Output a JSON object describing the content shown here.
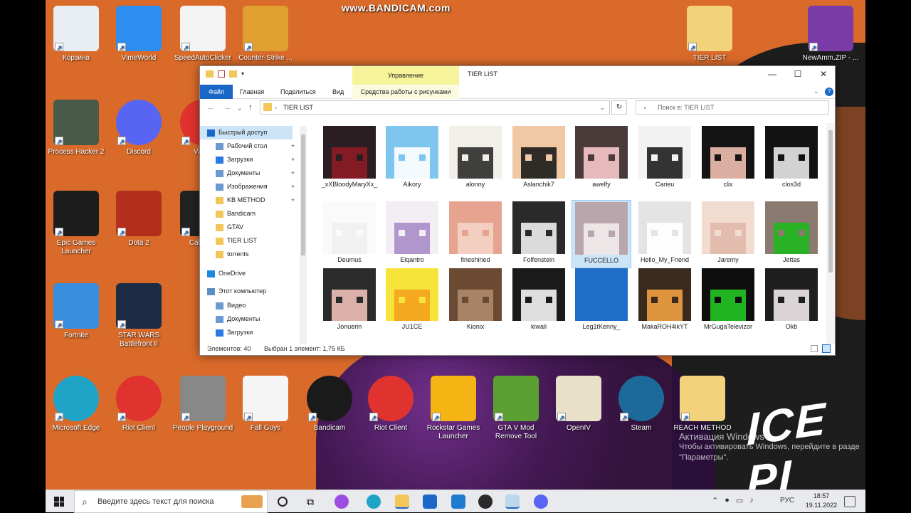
{
  "watermark": "www.BANDICAM.com",
  "desktop_icons": [
    {
      "label": "Корзина",
      "icon": "recycle-bin-icon",
      "color": "#e8eef3"
    },
    {
      "label": "VimeWorld",
      "icon": "vimeworld-icon",
      "color": "#2d8ef0"
    },
    {
      "label": "SpeedAutoClicker",
      "icon": "mouse-icon",
      "color": "#f3f3f3"
    },
    {
      "label": "Counter-Strike ...",
      "icon": "csgo-icon",
      "color": "#e0a030"
    },
    {
      "label": "TIER LIST",
      "icon": "folder-icon",
      "color": "#f3d27c"
    },
    {
      "label": "NewAmm.ZIP - ...",
      "icon": "winrar-icon",
      "color": "#7a3aa8"
    },
    {
      "label": "Process Hacker 2",
      "icon": "monitor-icon",
      "color": "#4a5a4a"
    },
    {
      "label": "Discord",
      "icon": "discord-icon",
      "color": "#5865f2"
    },
    {
      "label": "VALO",
      "icon": "riot-icon",
      "color": "#e0322e"
    },
    {
      "label": "Epic Games Launcher",
      "icon": "epic-games-icon",
      "color": "#1d1d1d"
    },
    {
      "label": "Dota 2",
      "icon": "dota-icon",
      "color": "#b32e1c"
    },
    {
      "label": "Call of D",
      "icon": "call-of-duty-icon",
      "color": "#222222"
    },
    {
      "label": "Fortnite",
      "icon": "fortnite-icon",
      "color": "#3a8ee0"
    },
    {
      "label": "STAR WARS Battlefront II",
      "icon": "star-wars-icon",
      "color": "#1b2c44"
    },
    {
      "label": "Microsoft Edge",
      "icon": "edge-icon",
      "color": "#1fa3c7"
    },
    {
      "label": "Riot Client",
      "icon": "riot-client-icon",
      "color": "#e0322e"
    },
    {
      "label": "People Playground",
      "icon": "people-playground-icon",
      "color": "#888888"
    },
    {
      "label": "Fall Guys",
      "icon": "file-icon",
      "color": "#f5f5f5"
    },
    {
      "label": "Bandicam",
      "icon": "bandicam-icon",
      "color": "#1a1a1a"
    },
    {
      "label": "Riot Client",
      "icon": "riot-client-icon",
      "color": "#e0322e"
    },
    {
      "label": "Rockstar Games Launcher",
      "icon": "rockstar-icon",
      "color": "#f4b414"
    },
    {
      "label": "GTA V Mod Remove Tool",
      "icon": "gta-icon",
      "color": "#5aa032"
    },
    {
      "label": "OpenIV",
      "icon": "openiv-icon",
      "color": "#e8e0c8"
    },
    {
      "label": "Steam",
      "icon": "steam-icon",
      "color": "#1b6a9a"
    },
    {
      "label": "REACH METHOD",
      "icon": "folder-icon",
      "color": "#f3d27c"
    }
  ],
  "explorer": {
    "context_group": "Управление",
    "context_tab": "Средства работы с рисунками",
    "title": "TIER LIST",
    "tabs": [
      "Файл",
      "Главная",
      "Поделиться",
      "Вид"
    ],
    "address": "TIER LIST",
    "search_placeholder": "Поиск в: TIER LIST",
    "nav": [
      {
        "label": "Быстрый доступ",
        "icon": "star-icon",
        "pinned": false
      },
      {
        "label": "Рабочий стол",
        "icon": "desktop-folder-icon",
        "pinned": true
      },
      {
        "label": "Загрузки",
        "icon": "download-icon",
        "pinned": true
      },
      {
        "label": "Документы",
        "icon": "documents-icon",
        "pinned": true
      },
      {
        "label": "Изображения",
        "icon": "pictures-icon",
        "pinned": true
      },
      {
        "label": "KB METHOD",
        "icon": "folder-icon",
        "pinned": true
      },
      {
        "label": "Bandicam",
        "icon": "folder-icon",
        "pinned": false
      },
      {
        "label": "GTAV",
        "icon": "folder-icon",
        "pinned": false
      },
      {
        "label": "TIER LIST",
        "icon": "folder-icon",
        "pinned": false
      },
      {
        "label": "torrents",
        "icon": "folder-icon",
        "pinned": false
      },
      {
        "label": "OneDrive",
        "icon": "onedrive-icon",
        "pinned": false
      },
      {
        "label": "Этот компьютер",
        "icon": "computer-icon",
        "pinned": false
      },
      {
        "label": "Видео",
        "icon": "video-icon",
        "pinned": false
      },
      {
        "label": "Документы",
        "icon": "documents-icon",
        "pinned": false
      },
      {
        "label": "Загрузки",
        "icon": "download-icon",
        "pinned": false
      }
    ],
    "files": [
      {
        "name": "_xXBloodyMaryXx_",
        "bg": "#2a1e22",
        "c2": "#8c1b24"
      },
      {
        "name": "Aikory",
        "bg": "#7fc6ee",
        "c2": "#ffffff"
      },
      {
        "name": "alonny",
        "bg": "#f2efe8",
        "c2": "#2b2b2b"
      },
      {
        "name": "Aslanchik7",
        "bg": "#f0c8a4",
        "c2": "#1a1a1a"
      },
      {
        "name": "awelfy",
        "bg": "#4a3a3a",
        "c2": "#f7c9cc"
      },
      {
        "name": "Carieu",
        "bg": "#f2f2f2",
        "c2": "#1e1e1e"
      },
      {
        "name": "clix",
        "bg": "#141414",
        "c2": "#f0c0b0"
      },
      {
        "name": "clos3d",
        "bg": "#121212",
        "c2": "#e8e8e8"
      },
      {
        "name": "Deumus",
        "bg": "#fafafa",
        "c2": "#f0f0f0"
      },
      {
        "name": "Elqantro",
        "bg": "#f2eef4",
        "c2": "#a98cc8"
      },
      {
        "name": "fineshined",
        "bg": "#e6a490",
        "c2": "#f4d4c6"
      },
      {
        "name": "Folfenstein",
        "bg": "#2a2a2a",
        "c2": "#f0eeee"
      },
      {
        "name": "FUCCELLO",
        "bg": "#b9a6ac",
        "c2": "#f2eded"
      },
      {
        "name": "Hello_My_Friend",
        "bg": "#e4e4e4",
        "c2": "#ffffff"
      },
      {
        "name": "Jaremy",
        "bg": "#f2dcd0",
        "c2": "#e0b8a8"
      },
      {
        "name": "Jettas",
        "bg": "#8a7a70",
        "c2": "#1eb81e"
      },
      {
        "name": "Jonuerin",
        "bg": "#2c2c2c",
        "c2": "#f0c0b8"
      },
      {
        "name": "JU1CE",
        "bg": "#f6e43a",
        "c2": "#f4a21e"
      },
      {
        "name": "Kionix",
        "bg": "#6a4a32",
        "c2": "#b08a6a"
      },
      {
        "name": "kiwali",
        "bg": "#1a1a1a",
        "c2": "#f4f4f4"
      },
      {
        "name": "Leg1tKenny_",
        "bg": "#1e6ec8",
        "c2": "#1e6ec8"
      },
      {
        "name": "MakaROH4ikYT",
        "bg": "#3a2a1e",
        "c2": "#f0a040"
      },
      {
        "name": "MrGugaTelevizor",
        "bg": "#0e0e0e",
        "c2": "#22c822"
      },
      {
        "name": "Okb",
        "bg": "#1e1e1e",
        "c2": "#f0e8ea"
      }
    ],
    "status_count": "Элементов: 40",
    "status_selected": "Выбран 1 элемент: 1,75 КБ"
  },
  "activation": {
    "title": "Активация Windows",
    "line1": "Чтобы активировать Windows, перейдите в разде",
    "line2": "\"Параметры\"."
  },
  "art_text": "ICE PI",
  "taskbar": {
    "search_placeholder": "Введите здесь текст для поиска",
    "language": "РУС",
    "time": "18:57",
    "date": "19.11.2022"
  }
}
